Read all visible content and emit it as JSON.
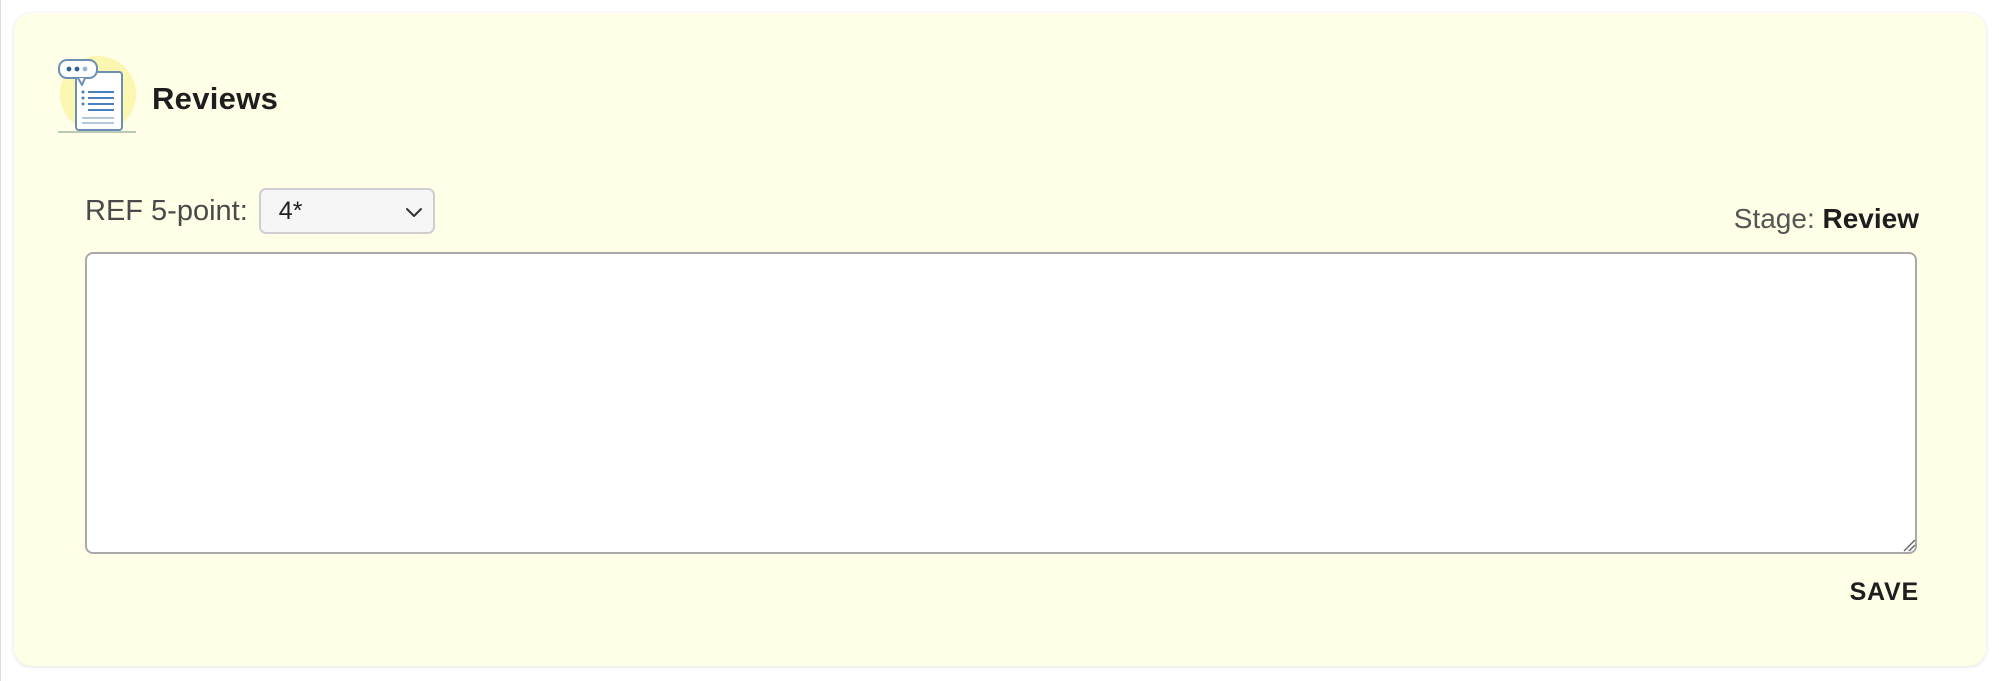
{
  "card": {
    "title": "Reviews",
    "icon": "review-document-icon"
  },
  "rating": {
    "label": "REF 5-point:",
    "selected": "4*"
  },
  "stage": {
    "label": "Stage:",
    "value": "Review"
  },
  "comment": {
    "value": "",
    "placeholder": ""
  },
  "actions": {
    "save_label": "SAVE"
  },
  "colors": {
    "card_background": "#fffee6",
    "icon_highlight": "#fbf7b0",
    "icon_accent": "#4a7fc1"
  }
}
